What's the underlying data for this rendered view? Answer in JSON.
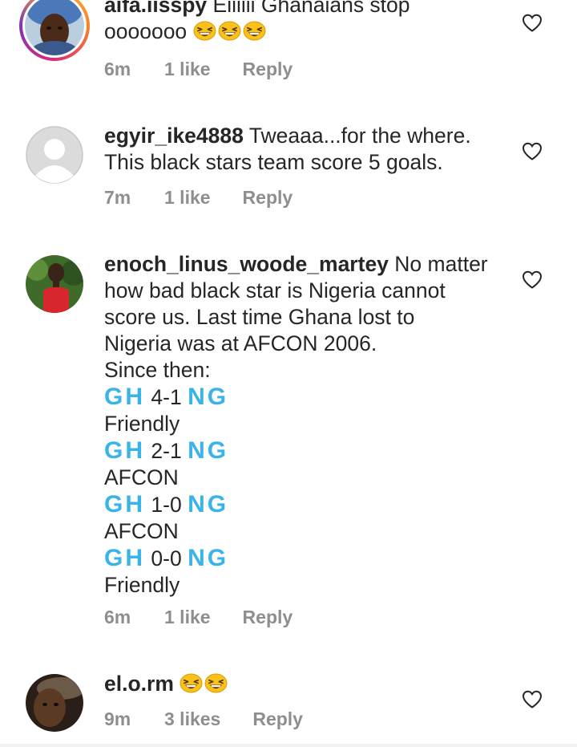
{
  "comments": [
    {
      "username": "aifa.iisspy",
      "lines": [
        "Eiiiiii Ghanaians stop",
        "ooooooo"
      ],
      "time": "6m",
      "likes": "1 like",
      "reply": "Reply",
      "avatar_icon": "person-photo",
      "emoji_icon": "grinning-squinting-face"
    },
    {
      "username": "egyir_ike4888",
      "lines": [
        "Tweaaa...for the where.",
        "This black stars team score 5 goals."
      ],
      "time": "7m",
      "likes": "1 like",
      "reply": "Reply",
      "avatar_icon": "default-avatar"
    },
    {
      "username": "enoch_linus_woode_martey",
      "lines": [
        "No matter",
        "how bad black star is Nigeria cannot",
        "score us.  Last time Ghana lost to",
        "Nigeria was at AFCON 2006.",
        "Since then:"
      ],
      "results": [
        {
          "home": "GH",
          "score": "4-1",
          "away": "NG",
          "type": "Friendly"
        },
        {
          "home": "GH",
          "score": "2-1",
          "away": "NG",
          "type": "AFCON"
        },
        {
          "home": "GH",
          "score": "1-0",
          "away": "NG",
          "type": "AFCON"
        },
        {
          "home": "GH",
          "score": "0-0",
          "away": "NG",
          "type": "Friendly"
        }
      ],
      "time": "6m",
      "likes": "1 like",
      "reply": "Reply",
      "avatar_icon": "person-photo-red-shirt"
    },
    {
      "username": "el.o.rm",
      "time": "9m",
      "likes": "3 likes",
      "reply": "Reply",
      "avatar_icon": "person-photo-dark",
      "emoji_icon": "grinning-squinting-face"
    }
  ],
  "colors": {
    "text": "#262626",
    "meta": "#8e8e8e",
    "flag_letters": "#3ab4e8",
    "story_ring": "#dd2a7b"
  }
}
